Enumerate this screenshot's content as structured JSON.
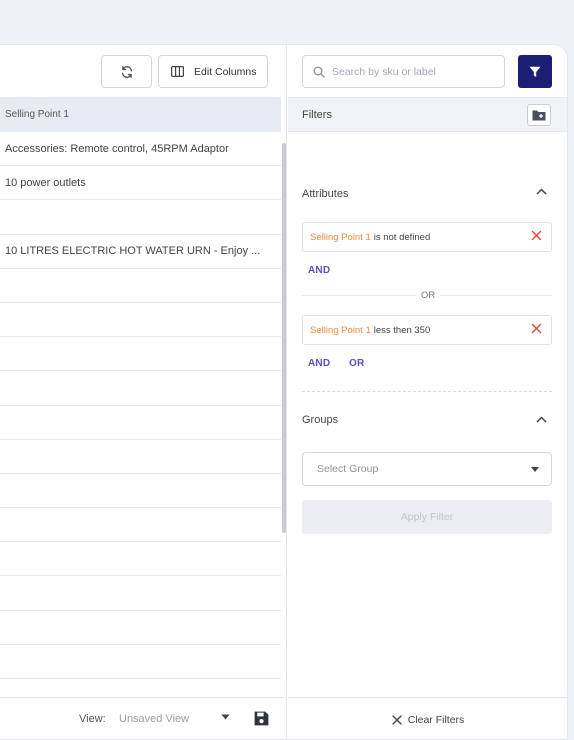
{
  "toolbar": {
    "edit_columns_label": "Edit Columns"
  },
  "table": {
    "column_header": "Selling Point 1",
    "rows": [
      "Accessories: Remote control, 45RPM Adaptor",
      "10 power outlets",
      "",
      "10 LITRES ELECTRIC HOT WATER URN - Enjoy ...",
      "",
      "",
      "",
      "",
      "",
      "",
      "",
      "",
      "",
      "",
      "",
      ""
    ]
  },
  "footer": {
    "view_label": "View:",
    "view_value": "Unsaved View",
    "clear_filters_label": "Clear Filters"
  },
  "search": {
    "placeholder": "Search by sku or label",
    "value": ""
  },
  "filters": {
    "title": "Filters",
    "attributes_title": "Attributes",
    "conditions": [
      {
        "attribute": "Selling Point 1",
        "rule": "is not defined"
      },
      {
        "attribute": "Selling Point 1",
        "rule": "less then 350"
      }
    ],
    "and_label": "AND",
    "or_label": "OR",
    "or_divider": "OR",
    "groups_title": "Groups",
    "select_group_placeholder": "Select Group",
    "apply_label": "Apply Filter"
  },
  "colors": {
    "accent": "#1b1f74",
    "attribute_text": "#f08a3c",
    "operator_text": "#5b4fc9",
    "close_icon": "#e0453a"
  }
}
